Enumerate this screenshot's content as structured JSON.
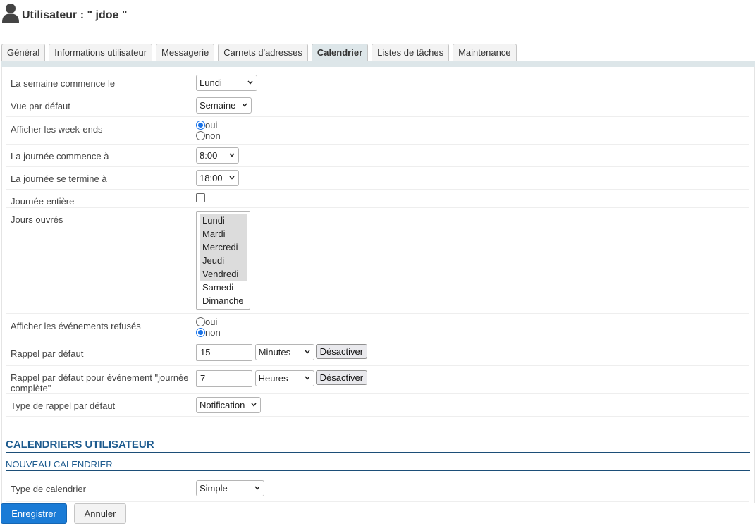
{
  "header": {
    "title": "Utilisateur : \" jdoe \""
  },
  "tabs": [
    {
      "label": "Général"
    },
    {
      "label": "Informations utilisateur"
    },
    {
      "label": "Messagerie"
    },
    {
      "label": "Carnets d'adresses"
    },
    {
      "label": "Calendrier"
    },
    {
      "label": "Listes de tâches"
    },
    {
      "label": "Maintenance"
    }
  ],
  "active_tab": "Calendrier",
  "form": {
    "week_start": {
      "label": "La semaine commence le",
      "value": "Lundi"
    },
    "default_view": {
      "label": "Vue par défaut",
      "value": "Semaine"
    },
    "show_weekends": {
      "label": "Afficher les week-ends",
      "opt_yes": "oui",
      "opt_no": "non",
      "selected": "oui"
    },
    "day_start": {
      "label": "La journée commence à",
      "value": "8:00"
    },
    "day_end": {
      "label": "La journée se termine à",
      "value": "18:00"
    },
    "all_day": {
      "label": "Journée entière",
      "checked": false
    },
    "work_days": {
      "label": "Jours ouvrés",
      "options": [
        {
          "label": "Lundi",
          "selected": true
        },
        {
          "label": "Mardi",
          "selected": true
        },
        {
          "label": "Mercredi",
          "selected": true
        },
        {
          "label": "Jeudi",
          "selected": true
        },
        {
          "label": "Vendredi",
          "selected": true
        },
        {
          "label": "Samedi",
          "selected": false
        },
        {
          "label": "Dimanche",
          "selected": false
        }
      ]
    },
    "show_declined": {
      "label": "Afficher les événements refusés",
      "opt_yes": "oui",
      "opt_no": "non",
      "selected": "non"
    },
    "default_reminder": {
      "label": "Rappel par défaut",
      "value": "15",
      "unit": "Minutes",
      "button": "Désactiver"
    },
    "default_reminder_allday": {
      "label": "Rappel par défaut pour événement \"journée complète\"",
      "value": "7",
      "unit": "Heures",
      "button": "Désactiver"
    },
    "reminder_type": {
      "label": "Type de rappel par défaut",
      "value": "Notification"
    }
  },
  "calendars": {
    "section_title": "CALENDRIERS UTILISATEUR",
    "subsection_title": "NOUVEAU CALENDRIER",
    "calendar_type": {
      "label": "Type de calendrier",
      "value": "Simple"
    }
  },
  "footer": {
    "save_label": "Enregistrer",
    "cancel_label": "Annuler"
  },
  "colors": {
    "accent": "#1a7bd6",
    "section_title": "#1c5a8e",
    "tab_active_bg": "#dde6e9",
    "radio_checked": "#1a73e8"
  },
  "icons": {
    "header_icon": "user-icon",
    "select_chevron": "chevron-down-icon"
  }
}
